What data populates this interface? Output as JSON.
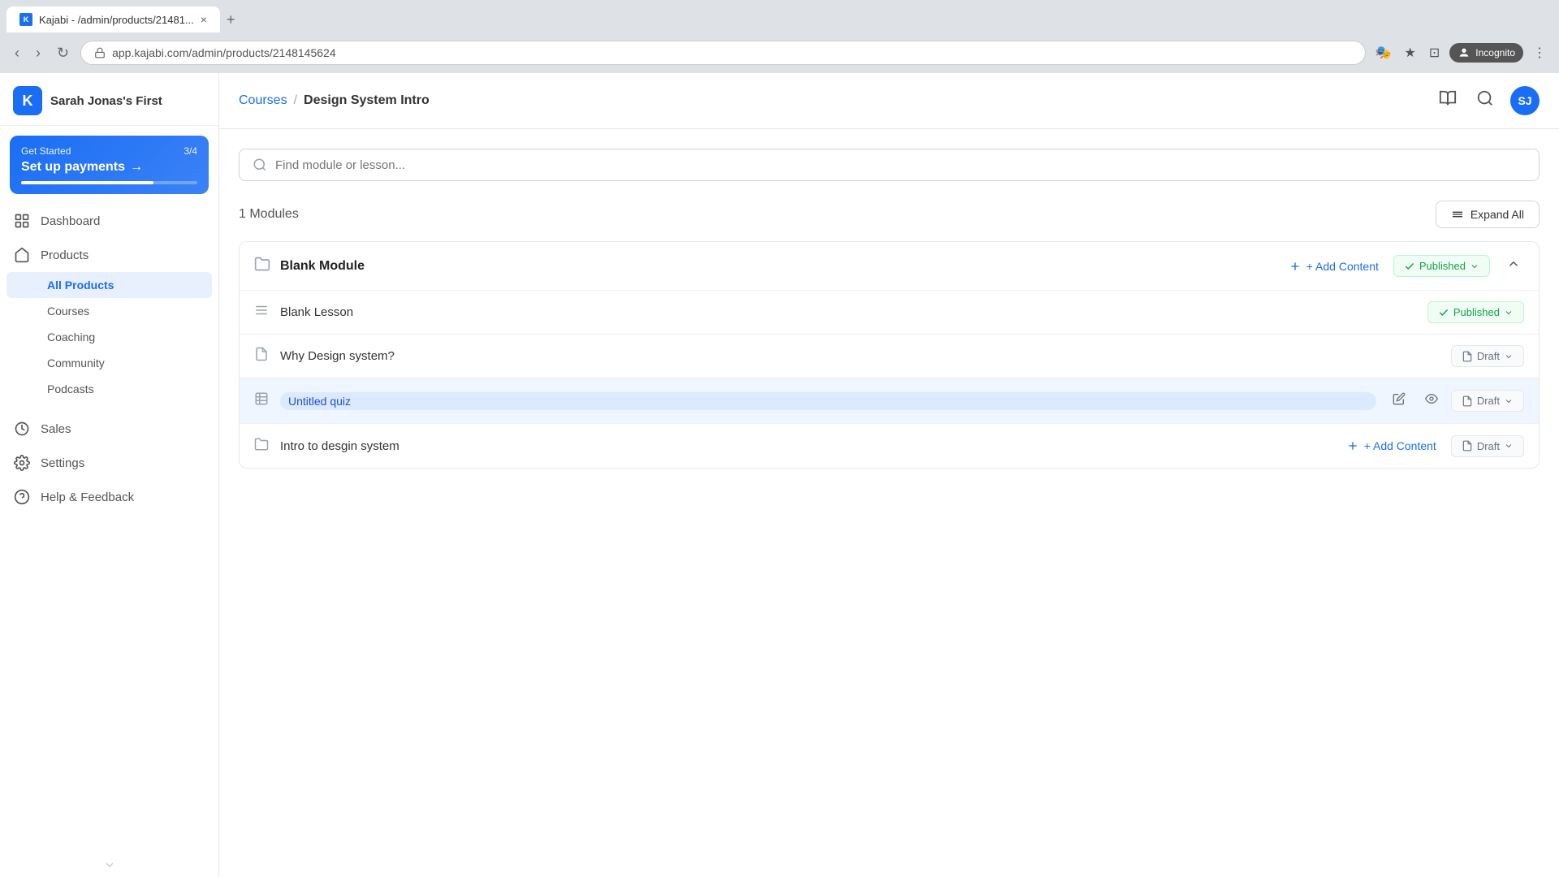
{
  "browser": {
    "tab_title": "Kajabi - /admin/products/21481...",
    "tab_close": "×",
    "tab_new": "+",
    "nav_back": "‹",
    "nav_forward": "›",
    "nav_refresh": "↻",
    "address": "app.kajabi.com/admin/products/2148145624",
    "incognito_label": "Incognito",
    "action_icons": [
      "🎭",
      "★",
      "⊡"
    ]
  },
  "sidebar": {
    "logo_letter": "K",
    "brand": "Sarah Jonas's First",
    "get_started": {
      "label": "Get Started",
      "progress": "3/4",
      "title": "Set up payments",
      "arrow": "→"
    },
    "nav_items": [
      {
        "id": "dashboard",
        "label": "Dashboard"
      },
      {
        "id": "products",
        "label": "Products"
      }
    ],
    "sub_items": [
      {
        "id": "all-products",
        "label": "All Products",
        "active": true
      },
      {
        "id": "courses",
        "label": "Courses"
      },
      {
        "id": "coaching",
        "label": "Coaching"
      },
      {
        "id": "community",
        "label": "Community"
      },
      {
        "id": "podcasts",
        "label": "Podcasts"
      }
    ],
    "bottom_items": [
      {
        "id": "sales",
        "label": "Sales"
      },
      {
        "id": "settings",
        "label": "Settings"
      },
      {
        "id": "help",
        "label": "Help & Feedback"
      }
    ]
  },
  "topbar": {
    "breadcrumb_link": "Courses",
    "breadcrumb_sep": "/",
    "breadcrumb_current": "Design System Intro"
  },
  "search": {
    "placeholder": "Find module or lesson..."
  },
  "modules_section": {
    "count_label": "1 Modules",
    "expand_all_label": "Expand All"
  },
  "module": {
    "title": "Blank Module",
    "add_content_label": "+ Add Content",
    "status": "Published",
    "status_type": "published"
  },
  "lessons": [
    {
      "id": "blank-lesson",
      "title": "Blank Lesson",
      "icon": "lines",
      "status": "Published",
      "status_type": "published",
      "has_add_content": false,
      "highlighted": false
    },
    {
      "id": "why-design-system",
      "title": "Why Design system?",
      "icon": "doc",
      "status": "Draft",
      "status_type": "draft",
      "has_add_content": false,
      "highlighted": false
    },
    {
      "id": "untitled-quiz",
      "title": "Untitled quiz",
      "icon": "quiz",
      "status": "Draft",
      "status_type": "draft",
      "has_add_content": false,
      "highlighted": true
    },
    {
      "id": "intro-to-design",
      "title": "Intro to desgin system",
      "icon": "folder",
      "status": "Draft",
      "status_type": "draft",
      "has_add_content": true,
      "highlighted": false
    }
  ],
  "avatar": {
    "initials": "SJ"
  }
}
